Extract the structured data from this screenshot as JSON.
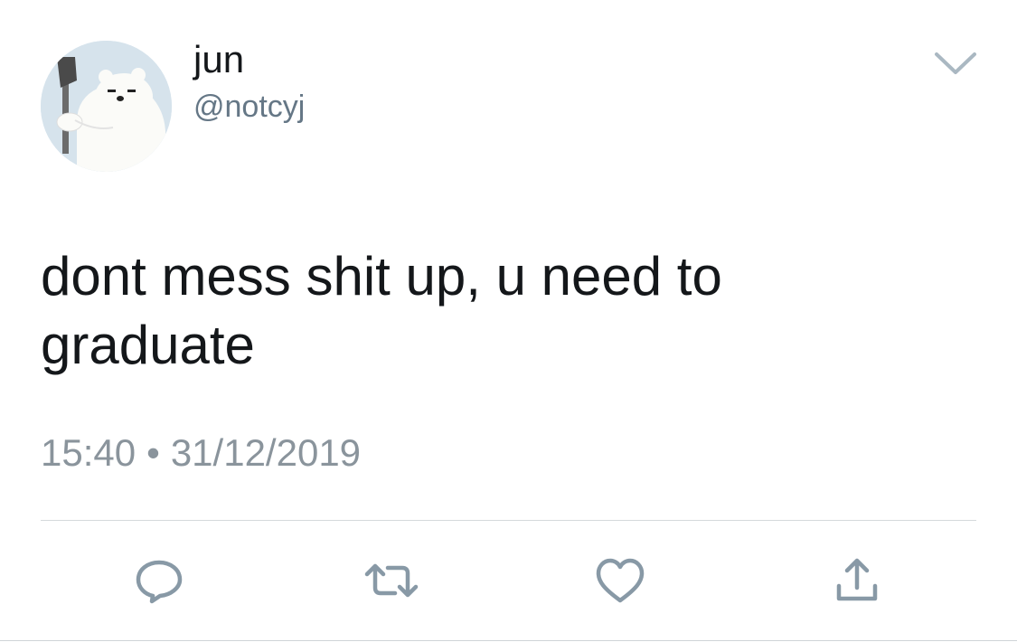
{
  "user": {
    "display_name": "jun",
    "handle": "@notcyj",
    "avatar_icon": "polar-bear-with-axe-avatar"
  },
  "tweet": {
    "text": "dont mess shit up, u need to graduate",
    "time": "15:40",
    "separator": "•",
    "date": "31/12/2019"
  },
  "actions": [
    {
      "icon": "reply-icon"
    },
    {
      "icon": "retweet-icon"
    },
    {
      "icon": "like-icon"
    },
    {
      "icon": "share-icon"
    }
  ],
  "colors": {
    "text": "#14171a",
    "secondary": "#657786",
    "timestamp": "#8a949c",
    "icon": "#8899a6",
    "divider": "#d5d9dc"
  }
}
